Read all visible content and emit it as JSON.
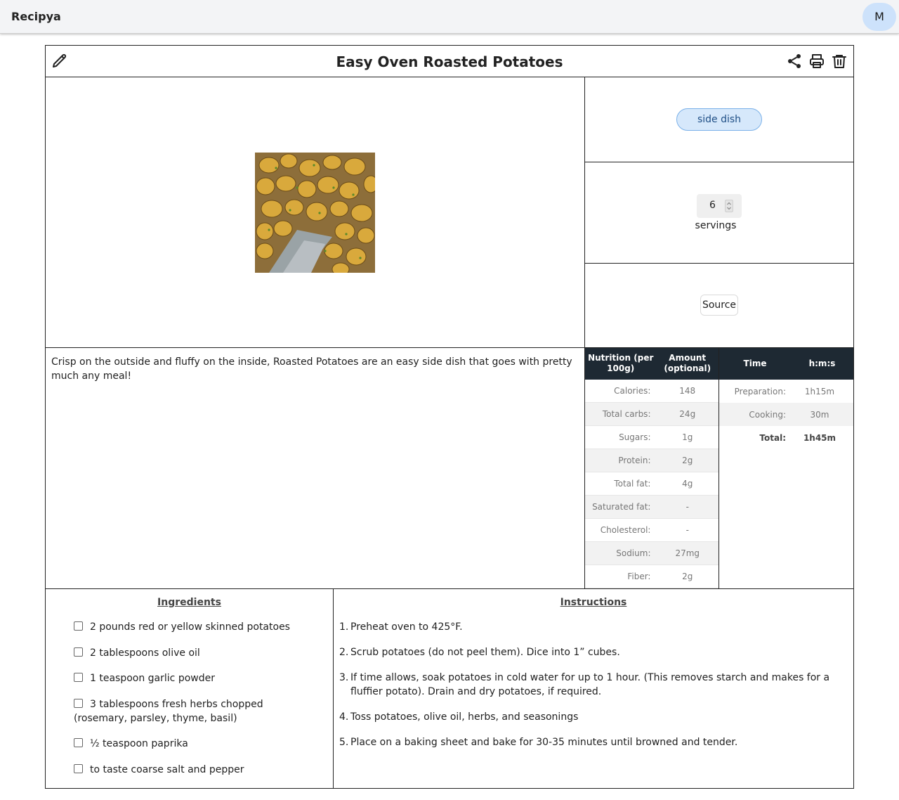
{
  "app": {
    "name": "Recipya",
    "avatar_letter": "M"
  },
  "recipe": {
    "title": "Easy Oven Roasted Potatoes",
    "category_tag": "side dish",
    "servings_value": "6",
    "servings_label": "servings",
    "source_label": "Source",
    "description": "Crisp on the outside and fluffy on the inside, Roasted Potatoes are an easy side dish that goes with pretty much any meal!"
  },
  "nutrition": {
    "header_col1": "Nutrition (per 100g)",
    "header_col2": "Amount (optional)",
    "rows": [
      {
        "label": "Calories:",
        "value": "148"
      },
      {
        "label": "Total carbs:",
        "value": "24g"
      },
      {
        "label": "Sugars:",
        "value": "1g"
      },
      {
        "label": "Protein:",
        "value": "2g"
      },
      {
        "label": "Total fat:",
        "value": "4g"
      },
      {
        "label": "Saturated fat:",
        "value": "-"
      },
      {
        "label": "Cholesterol:",
        "value": "-"
      },
      {
        "label": "Sodium:",
        "value": "27mg"
      },
      {
        "label": "Fiber:",
        "value": "2g"
      }
    ]
  },
  "times": {
    "header_col1": "Time",
    "header_col2": "h:m:s",
    "rows": [
      {
        "label": "Preparation:",
        "value": "1h15m"
      },
      {
        "label": "Cooking:",
        "value": "30m"
      },
      {
        "label": "Total:",
        "value": "1h45m"
      }
    ]
  },
  "ingredients": {
    "heading": "Ingredients",
    "items": [
      "2 pounds red or yellow skinned potatoes",
      "2 tablespoons olive oil",
      "1 teaspoon garlic powder",
      "3 tablespoons fresh herbs chopped (rosemary, parsley, thyme, basil)",
      "½ teaspoon paprika",
      "to taste coarse salt and pepper"
    ]
  },
  "instructions": {
    "heading": "Instructions",
    "steps": [
      {
        "num": "1.",
        "text": "Preheat oven to 425°F."
      },
      {
        "num": "2.",
        "text": "Scrub potatoes (do not peel them). Dice into 1” cubes."
      },
      {
        "num": "3.",
        "text": "If time allows, soak potatoes in cold water for up to 1 hour. (This removes starch and makes for a fluffier potato). Drain and dry potatoes, if required."
      },
      {
        "num": "4.",
        "text": "Toss potatoes, olive oil, herbs, and seasonings"
      },
      {
        "num": "5.",
        "text": "Place on a baking sheet and bake for 30-35 minutes until browned and tender."
      }
    ]
  },
  "icons": {
    "edit": "pencil-icon",
    "share": "share-icon",
    "print": "printer-icon",
    "delete": "trash-icon",
    "spinner": "chevron-up-down-icon"
  }
}
